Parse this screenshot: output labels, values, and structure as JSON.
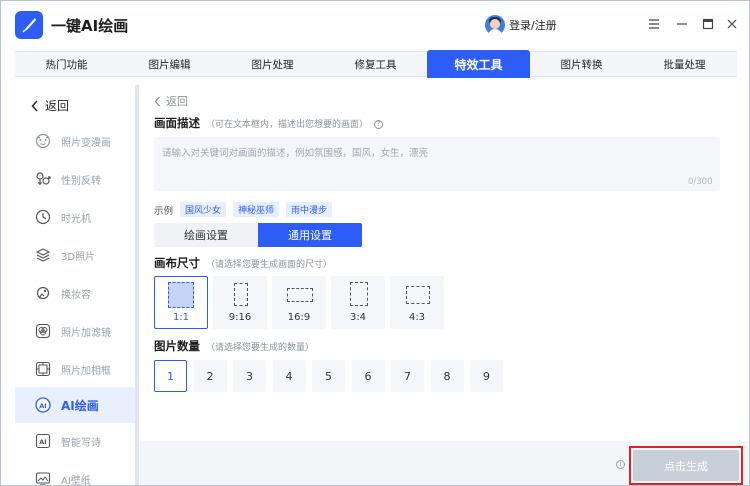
{
  "app": {
    "title": "一键AI绘画"
  },
  "user": {
    "login_label": "登录/注册"
  },
  "tabs": [
    {
      "label": "热门功能"
    },
    {
      "label": "图片编辑"
    },
    {
      "label": "图片处理"
    },
    {
      "label": "修复工具"
    },
    {
      "label": "特效工具",
      "active": true
    },
    {
      "label": "图片转换"
    },
    {
      "label": "批量处理"
    }
  ],
  "sidebar": {
    "back_label": "返回",
    "items": [
      {
        "label": "照片变漫画",
        "icon": "cartoon-face-icon"
      },
      {
        "label": "性别反转",
        "icon": "gender-icon"
      },
      {
        "label": "时光机",
        "icon": "time-machine-icon"
      },
      {
        "label": "3D照片",
        "icon": "layers-3d-icon"
      },
      {
        "label": "换妆容",
        "icon": "makeup-icon"
      },
      {
        "label": "照片加滤镜",
        "icon": "filter-icon"
      },
      {
        "label": "照片加相框",
        "icon": "photo-frame-icon"
      },
      {
        "label": "AI绘画",
        "icon": "ai-paint-icon",
        "active": true
      },
      {
        "label": "智能写诗",
        "icon": "ai-poem-icon"
      },
      {
        "label": "AI壁纸",
        "icon": "wallpaper-icon"
      }
    ]
  },
  "main": {
    "back_label": "返回",
    "description": {
      "title": "画面描述",
      "hint": "（可在文本框内，描述出您想要的画面）",
      "placeholder": "请输入对关键词对画面的描述，例如氛围感，国风，女生，漂亮",
      "counter": "0/300"
    },
    "examples": {
      "label": "示例",
      "chips": [
        "国风少女",
        "神秘巫师",
        "雨中漫步"
      ]
    },
    "settings_tabs": [
      {
        "label": "绘画设置"
      },
      {
        "label": "通用设置",
        "active": true
      }
    ],
    "canvas_size": {
      "title": "画布尺寸",
      "hint": "（请选择您要生成画面的尺寸）",
      "options": [
        "1:1",
        "9:16",
        "16:9",
        "3:4",
        "4:3"
      ],
      "selected": "1:1"
    },
    "image_count": {
      "title": "图片数量",
      "hint": "（请选择您要生成的数量）",
      "options": [
        "1",
        "2",
        "3",
        "4",
        "5",
        "6",
        "7",
        "8",
        "9"
      ],
      "selected": "1"
    }
  },
  "bottom": {
    "generate_label": "点击生成"
  },
  "colors": {
    "accent": "#2d5cf6",
    "highlight_border": "#e02424",
    "disabled_button": "#c9cfd8"
  }
}
